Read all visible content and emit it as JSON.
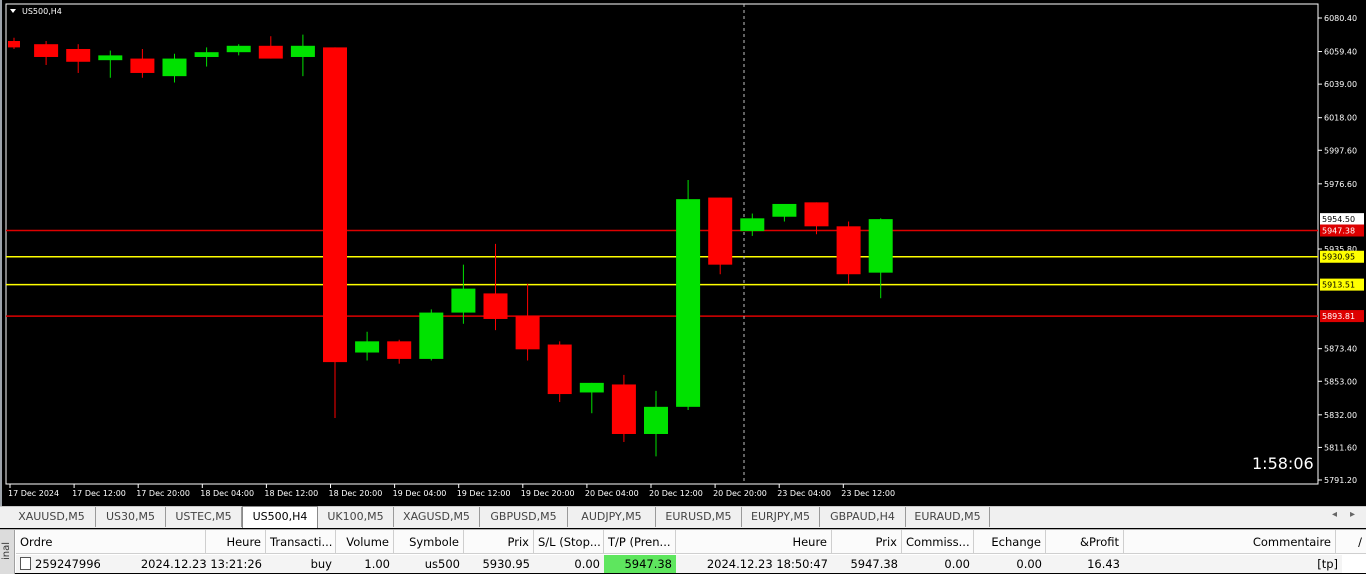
{
  "chart": {
    "symbol_label": "US500,H4",
    "countdown": "1:58:06",
    "price_ticks": [
      "6080.40",
      "6059.40",
      "6039.00",
      "6018.00",
      "5997.60",
      "5976.60",
      "5935.80",
      "5873.40",
      "5853.00",
      "5832.00",
      "5811.60",
      "5791.20"
    ],
    "time_ticks": [
      "17 Dec 2024",
      "17 Dec 12:00",
      "17 Dec 20:00",
      "18 Dec 04:00",
      "18 Dec 12:00",
      "18 Dec 20:00",
      "19 Dec 04:00",
      "19 Dec 12:00",
      "19 Dec 20:00",
      "20 Dec 04:00",
      "20 Dec 12:00",
      "20 Dec 20:00",
      "23 Dec 04:00",
      "23 Dec 12:00"
    ],
    "levels": [
      {
        "price": 5954.5,
        "label": "5954.50",
        "color": "#ffffff",
        "line": false,
        "text_color": "#000000"
      },
      {
        "price": 5947.38,
        "label": "5947.38",
        "color": "#dd0000",
        "line": true,
        "text_color": "#ffffff"
      },
      {
        "price": 5930.95,
        "label": "5930.95",
        "color": "#ffff00",
        "line": true,
        "text_color": "#000000"
      },
      {
        "price": 5913.51,
        "label": "5913.51",
        "color": "#ffff00",
        "line": true,
        "text_color": "#000000"
      },
      {
        "price": 5893.81,
        "label": "5893.81",
        "color": "#dd0000",
        "line": true,
        "text_color": "#ffffff"
      }
    ],
    "colors": {
      "bull": "#00e200",
      "bear": "#ff0000",
      "grid_text": "#ffffff",
      "crosshair": "#c0c0c0"
    }
  },
  "chart_data": {
    "type": "candlestick",
    "symbol": "US500",
    "timeframe": "H4",
    "ylim": [
      5791.2,
      6080.4
    ],
    "candles": [
      {
        "o": 6066,
        "h": 6068,
        "l": 6061,
        "c": 6062
      },
      {
        "o": 6064,
        "h": 6066,
        "l": 6051,
        "c": 6056
      },
      {
        "o": 6061,
        "h": 6064,
        "l": 6046,
        "c": 6053
      },
      {
        "o": 6054,
        "h": 6060,
        "l": 6043,
        "c": 6057
      },
      {
        "o": 6055,
        "h": 6061,
        "l": 6043,
        "c": 6046
      },
      {
        "o": 6044,
        "h": 6058,
        "l": 6040,
        "c": 6055
      },
      {
        "o": 6056,
        "h": 6062,
        "l": 6050,
        "c": 6059
      },
      {
        "o": 6059,
        "h": 6064,
        "l": 6057,
        "c": 6063
      },
      {
        "o": 6063,
        "h": 6069,
        "l": 6055,
        "c": 6055
      },
      {
        "o": 6056,
        "h": 6070,
        "l": 6044,
        "c": 6063
      },
      {
        "o": 6062,
        "h": 6062,
        "l": 5830,
        "c": 5865
      },
      {
        "o": 5871,
        "h": 5884,
        "l": 5866,
        "c": 5878
      },
      {
        "o": 5878,
        "h": 5879,
        "l": 5864,
        "c": 5867
      },
      {
        "o": 5867,
        "h": 5898,
        "l": 5866,
        "c": 5896
      },
      {
        "o": 5896,
        "h": 5926,
        "l": 5889,
        "c": 5911
      },
      {
        "o": 5908,
        "h": 5939,
        "l": 5885,
        "c": 5892
      },
      {
        "o": 5894,
        "h": 5914,
        "l": 5866,
        "c": 5873
      },
      {
        "o": 5876,
        "h": 5878,
        "l": 5840,
        "c": 5845
      },
      {
        "o": 5846,
        "h": 5852,
        "l": 5833,
        "c": 5852
      },
      {
        "o": 5851,
        "h": 5857,
        "l": 5815,
        "c": 5820
      },
      {
        "o": 5820,
        "h": 5847,
        "l": 5806,
        "c": 5837
      },
      {
        "o": 5837,
        "h": 5979,
        "l": 5835,
        "c": 5967
      },
      {
        "o": 5968,
        "h": 5968,
        "l": 5920,
        "c": 5926
      },
      {
        "o": 5947,
        "h": 5958,
        "l": 5944,
        "c": 5955
      },
      {
        "o": 5956,
        "h": 5963,
        "l": 5953,
        "c": 5964
      },
      {
        "o": 5965,
        "h": 5965,
        "l": 5945,
        "c": 5950
      },
      {
        "o": 5950,
        "h": 5953,
        "l": 5914,
        "c": 5920
      },
      {
        "o": 5921,
        "h": 5955,
        "l": 5905,
        "c": 5954.5
      }
    ]
  },
  "tabs": [
    {
      "label": "XAUUSD,M5",
      "active": false
    },
    {
      "label": "US30,M5",
      "active": false
    },
    {
      "label": "USTEC,M5",
      "active": false
    },
    {
      "label": "US500,H4",
      "active": true
    },
    {
      "label": "UK100,M5",
      "active": false
    },
    {
      "label": "XAGUSD,M5",
      "active": false
    },
    {
      "label": "GBPUSD,M5",
      "active": false
    },
    {
      "label": "AUDJPY,M5",
      "active": false
    },
    {
      "label": "EURUSD,M5",
      "active": false
    },
    {
      "label": "EURJPY,M5",
      "active": false
    },
    {
      "label": "GBPAUD,H4",
      "active": false
    },
    {
      "label": "EURAUD,M5",
      "active": false
    }
  ],
  "tab_nav": {
    "left": "◂",
    "right": "▸"
  },
  "terminal": {
    "side_label": "inal",
    "headers": [
      "Ordre",
      "Heure",
      "Transacti...",
      "Volume",
      "Symbole",
      "Prix",
      "S/L (Stop...",
      "T/P (Pren...",
      "Heure",
      "Prix",
      "Commiss...",
      "Echange",
      "&Profit",
      "Commentaire",
      "/"
    ],
    "row": {
      "order": "259247996",
      "open_time": "2024.12.23 13:21:26",
      "type": "buy",
      "volume": "1.00",
      "symbol": "us500",
      "open_price": "5930.95",
      "sl": "0.00",
      "tp": "5947.38",
      "close_time": "2024.12.23 18:50:47",
      "close_price": "5947.38",
      "commission": "0.00",
      "swap": "0.00",
      "profit": "16.43",
      "comment": "[tp]"
    }
  }
}
